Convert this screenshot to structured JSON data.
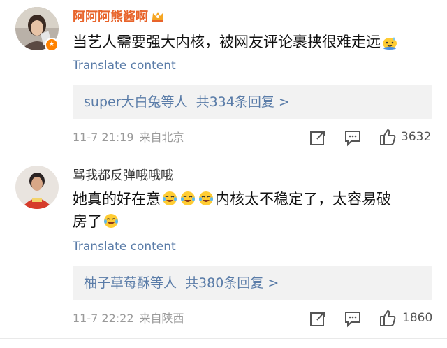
{
  "comments": [
    {
      "username": "阿阿阿熊酱啊",
      "text": "当艺人需要强大内核，被网友评论裹挟很难走远",
      "translate": "Translate content",
      "replies": {
        "users": "super大白兔",
        "suffix": "等人",
        "count_text": "共334条回复 >"
      },
      "time": "11-7 21:19",
      "location": "来自北京",
      "likes": "3632"
    },
    {
      "username": "骂我都反弹哦哦哦",
      "text_line1": "她真的好在意",
      "text_line1b": "内核太不稳定了，太容易破",
      "text_line2": "房了",
      "translate": "Translate content",
      "replies": {
        "users": "柚子草莓酥",
        "suffix": "等人",
        "count_text": "共380条回复 >"
      },
      "time": "11-7 22:22",
      "location": "来自陕西",
      "likes": "1860"
    }
  ],
  "icons": {
    "share": "share-icon",
    "comment": "comment-icon",
    "like": "like-icon",
    "crown": "crown-icon",
    "emoji_sweat": "sweat-emoji-icon",
    "emoji_laugh": "laugh-cry-emoji-icon"
  },
  "colors": {
    "vip_name": "#e8642b",
    "link": "#5a7ca8",
    "meta": "#9a9a9a",
    "reply_bg": "#f2f2f2"
  }
}
